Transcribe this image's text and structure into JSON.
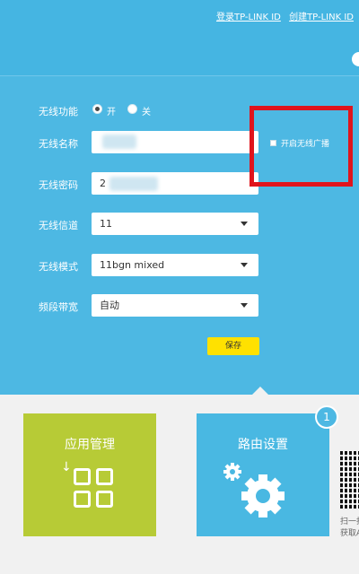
{
  "header": {
    "login_link": "登录TP-LINK ID",
    "create_link": "创建TP-LINK ID"
  },
  "form": {
    "wireless_function": {
      "label": "无线功能",
      "on_label": "开",
      "off_label": "关",
      "selected": "on"
    },
    "ssid": {
      "label": "无线名称",
      "value": ""
    },
    "password": {
      "label": "无线密码",
      "value": "2"
    },
    "channel": {
      "label": "无线信道",
      "value": "11"
    },
    "mode": {
      "label": "无线模式",
      "value": "11bgn mixed"
    },
    "bandwidth": {
      "label": "频段带宽",
      "value": "自动"
    },
    "broadcast": {
      "label": "开启无线广播",
      "checked": false
    },
    "save_label": "保存"
  },
  "tiles": {
    "app_management": "应用管理",
    "router_settings": "路由设置",
    "badge": "1"
  },
  "qr": {
    "line1": "扫一扫",
    "line2": "获取APP"
  },
  "colors": {
    "background": "#4db8e3",
    "highlight": "#e0141c",
    "save": "#ffe100",
    "app_tile": "#b7cb36",
    "router_tile": "#49b8e2"
  }
}
